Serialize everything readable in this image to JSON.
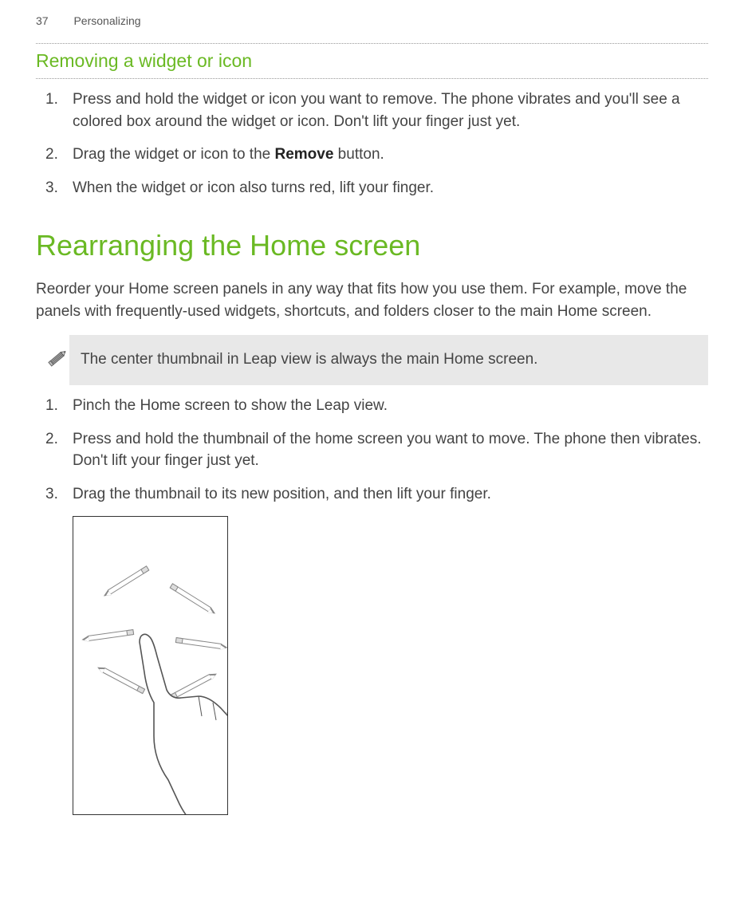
{
  "header": {
    "pageNumber": "37",
    "sectionName": "Personalizing"
  },
  "section1": {
    "title": "Removing a widget or icon",
    "steps": [
      {
        "pre": "Press and hold the widget or icon you want to remove. The phone vibrates and you'll see a colored box around the widget or icon. Don't lift your finger just yet."
      },
      {
        "pre": "Drag the widget or icon to the ",
        "bold": "Remove",
        "post": " button."
      },
      {
        "pre": "When the widget or icon also turns red, lift your finger."
      }
    ]
  },
  "section2": {
    "title": "Rearranging the Home screen",
    "intro": "Reorder your Home screen panels in any way that fits how you use them. For example, move the panels with frequently-used widgets, shortcuts, and folders closer to the main Home screen.",
    "note": "The center thumbnail in Leap view is always the main Home screen.",
    "steps": [
      {
        "pre": "Pinch the Home screen to show the Leap view."
      },
      {
        "pre": "Press and hold the thumbnail of the home screen you want to move. The phone then vibrates. Don't lift your finger just yet."
      },
      {
        "pre": "Drag the thumbnail to its new position, and then lift your finger."
      }
    ]
  }
}
